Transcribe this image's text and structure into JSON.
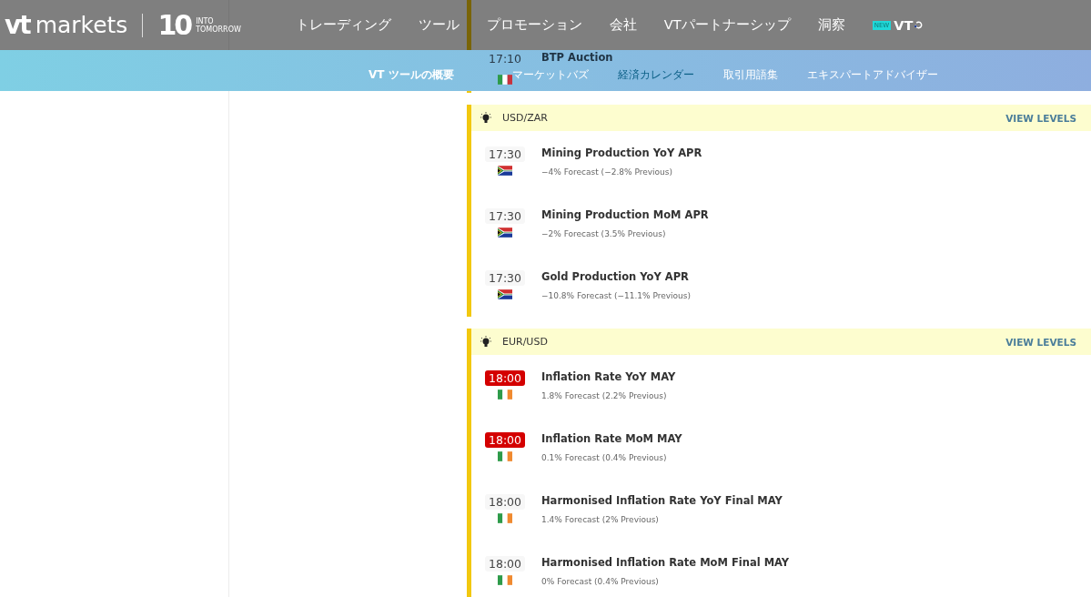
{
  "header": {
    "logo": {
      "mark": "vt",
      "name": "markets",
      "anniversary": "10",
      "tagline_1": "INTO",
      "tagline_2": "TOMORROW"
    },
    "nav": [
      {
        "label": "トレーディング"
      },
      {
        "label": "ツール"
      },
      {
        "label": "プロモーション"
      },
      {
        "label": "会社"
      },
      {
        "label": "VTパートナーシップ"
      },
      {
        "label": "洞察"
      },
      {
        "label": "VT",
        "badge": "NEW"
      }
    ]
  },
  "subnav": [
    {
      "label": "VT ツールの概要",
      "selected": false
    },
    {
      "label": "マーケットバズ",
      "selected": false
    },
    {
      "label": "経済カレンダー",
      "selected": true
    },
    {
      "label": "取引用語集",
      "selected": false
    },
    {
      "label": "エキスパートアドバイザー",
      "selected": false
    }
  ],
  "calendar": {
    "groups": [
      {
        "events": [
          {
            "time": "17:10",
            "highlighted": false,
            "flag": {
              "kind": "italy"
            },
            "title": "BTP Auction"
          }
        ]
      },
      {
        "pair": "USD/ZAR",
        "action": "VIEW LEVELS",
        "events": [
          {
            "time": "17:30",
            "highlighted": false,
            "flag": {
              "kind": "south-africa"
            },
            "title": "Mining Production YoY APR",
            "detail": "−4% Forecast (−2.8% Previous)"
          },
          {
            "time": "17:30",
            "highlighted": false,
            "flag": {
              "kind": "south-africa"
            },
            "title": "Mining Production MoM APR",
            "detail": "−2% Forecast (3.5% Previous)"
          },
          {
            "time": "17:30",
            "highlighted": false,
            "flag": {
              "kind": "south-africa"
            },
            "title": "Gold Production YoY APR",
            "detail": "−10.8% Forecast (−11.1% Previous)"
          }
        ]
      },
      {
        "pair": "EUR/USD",
        "action": "VIEW LEVELS",
        "events": [
          {
            "time": "18:00",
            "highlighted": true,
            "flag": {
              "kind": "ireland"
            },
            "title": "Inflation Rate YoY MAY",
            "detail": "1.8% Forecast (2.2% Previous)"
          },
          {
            "time": "18:00",
            "highlighted": true,
            "flag": {
              "kind": "ireland"
            },
            "title": "Inflation Rate MoM MAY",
            "detail": "0.1% Forecast (0.4% Previous)"
          },
          {
            "time": "18:00",
            "highlighted": false,
            "flag": {
              "kind": "ireland"
            },
            "title": "Harmonised Inflation Rate YoY Final MAY",
            "detail": "1.4% Forecast (2% Previous)"
          },
          {
            "time": "18:00",
            "highlighted": false,
            "flag": {
              "kind": "ireland"
            },
            "title": "Harmonised Inflation Rate MoM Final MAY",
            "detail": "0% Forecast (0.4% Previous)"
          }
        ]
      }
    ]
  }
}
